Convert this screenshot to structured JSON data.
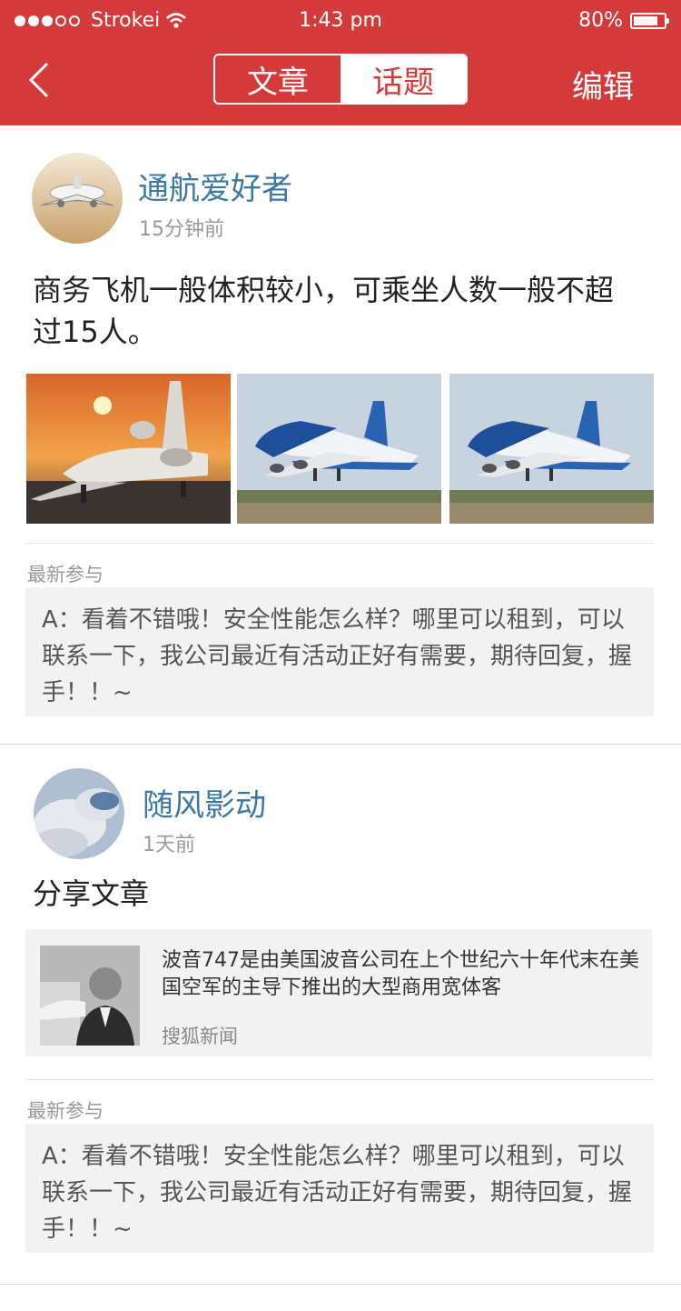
{
  "status_bar": {
    "carrier": "Strokei",
    "time": "1:43 pm",
    "battery": "80%",
    "battery_level": 0.8
  },
  "nav": {
    "tabs": [
      {
        "label": "文章",
        "active": false
      },
      {
        "label": "话题",
        "active": true
      }
    ],
    "edit_label": "编辑"
  },
  "posts": [
    {
      "author": "通航爱好者",
      "time": "15分钟前",
      "text_line1": "商务飞机一般体积较小，可乘坐人数一般不超",
      "text_line2": "过15人。",
      "latest_label": "最新参与",
      "comment": "A：看着不错哦！安全性能怎么样？哪里可以租到，可以联系一下，我公司最近有活动正好有需要，期待回复，握手！！~"
    },
    {
      "author": "随风影动",
      "time": "1天前",
      "text": "分享文章",
      "article": {
        "title": "波音747是由美国波音公司在上个世纪六十年代末在美国空军的主导下推出的大型商用宽体客",
        "source": "搜狐新闻"
      },
      "latest_label": "最新参与",
      "comment": "A：看着不错哦！安全性能怎么样？哪里可以租到，可以联系一下，我公司最近有活动正好有需要，期待回复，握手！！~"
    }
  ],
  "colors": {
    "brand_red": "#d43a3a",
    "author_blue": "#3b78a6"
  }
}
